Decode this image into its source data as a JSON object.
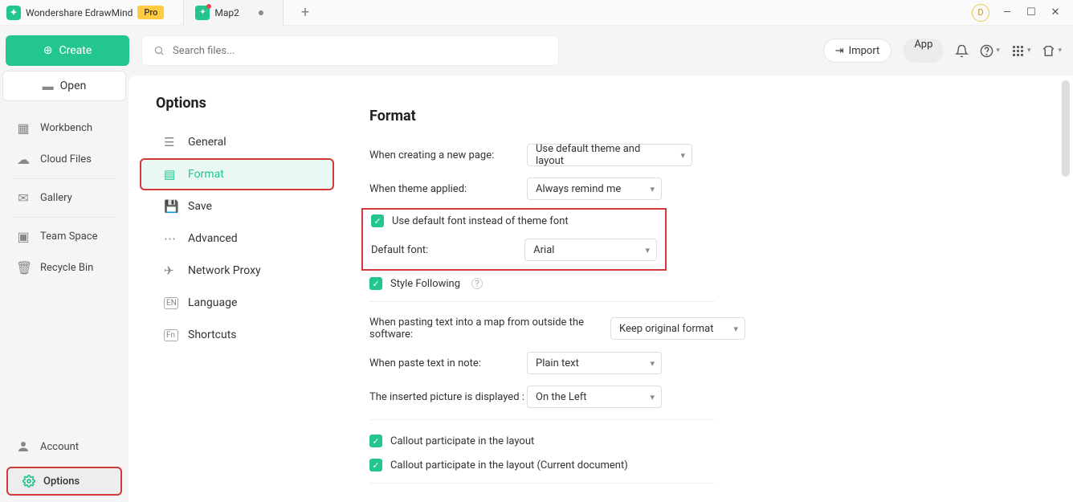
{
  "app": {
    "name": "Wondershare EdrawMind",
    "badge": "Pro"
  },
  "tab": {
    "title": "Map2"
  },
  "avatar_letter": "D",
  "toolbar": {
    "create": "Create",
    "open": "Open",
    "search_placeholder": "Search files...",
    "import": "Import",
    "app": "App"
  },
  "sidebar": {
    "items": [
      {
        "label": "Workbench"
      },
      {
        "label": "Cloud Files"
      },
      {
        "label": "Gallery"
      },
      {
        "label": "Team Space"
      },
      {
        "label": "Recycle Bin"
      }
    ],
    "account": "Account",
    "options": "Options"
  },
  "options_panel": {
    "title": "Options",
    "items": [
      {
        "label": "General"
      },
      {
        "label": "Format"
      },
      {
        "label": "Save"
      },
      {
        "label": "Advanced"
      },
      {
        "label": "Network Proxy"
      },
      {
        "label": "Language"
      },
      {
        "label": "Shortcuts"
      }
    ]
  },
  "format": {
    "heading": "Format",
    "rows": {
      "new_page_label": "When creating a new page:",
      "new_page_value": "Use default theme and layout",
      "theme_applied_label": "When theme applied:",
      "theme_applied_value": "Always remind me",
      "use_default_font": "Use default font instead of theme font",
      "default_font_label": "Default font:",
      "default_font_value": "Arial",
      "style_following": "Style Following",
      "paste_into_map_label": "When pasting text into a map from outside the software:",
      "paste_into_map_value": "Keep original format",
      "paste_note_label": "When paste text in note:",
      "paste_note_value": "Plain text",
      "pic_displayed_label": "The inserted picture is displayed :",
      "pic_displayed_value": "On the Left",
      "callout_layout": "Callout participate in the layout",
      "callout_layout_current": "Callout participate in the layout (Current document)"
    }
  }
}
